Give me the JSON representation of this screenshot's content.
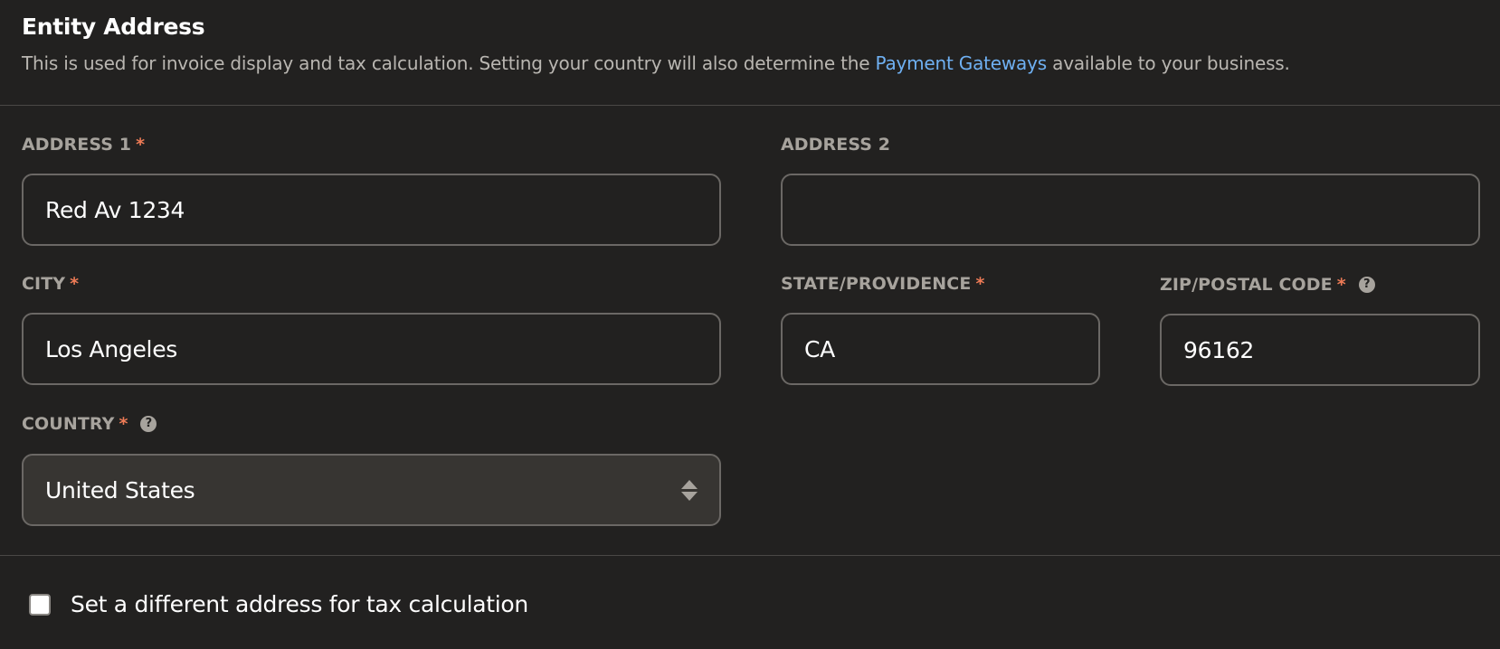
{
  "section": {
    "title": "Entity Address",
    "description_before": "This is used for invoice display and tax calculation. Setting your country will also determine the ",
    "description_link": "Payment Gateways",
    "description_after": " available to your business."
  },
  "fields": {
    "address1": {
      "label": "ADDRESS 1",
      "required": "*",
      "value": "Red Av 1234"
    },
    "address2": {
      "label": "ADDRESS 2",
      "value": ""
    },
    "city": {
      "label": "CITY",
      "required": "*",
      "value": "Los Angeles"
    },
    "state": {
      "label": "STATE/PROVIDENCE",
      "required": "*",
      "value": "CA"
    },
    "zip": {
      "label": "ZIP/POSTAL CODE",
      "required": "*",
      "help": "?",
      "value": "96162"
    },
    "country": {
      "label": "COUNTRY",
      "required": "*",
      "help": "?",
      "value": "United States"
    }
  },
  "tax_checkbox": {
    "label": "Set a different address for tax calculation",
    "checked": false
  },
  "colors": {
    "background": "#222120",
    "link": "#6fb0f2",
    "required": "#ee7b56",
    "label": "#a7a39d",
    "border": "#6b6865"
  }
}
